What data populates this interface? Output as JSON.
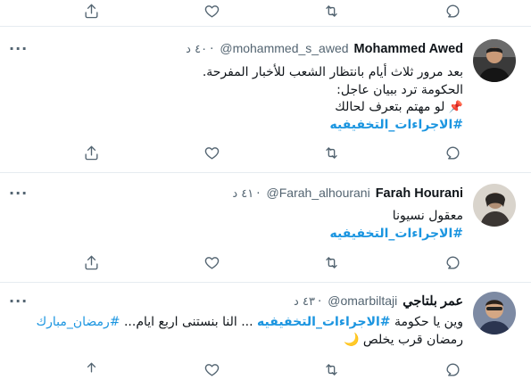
{
  "tweets": [
    {
      "name": "Mohammed Awed",
      "handle": "@mohammed_s_awed",
      "time": "٤٠ د",
      "line1": "بعد مرور ثلاث أيام بانتظار الشعب للأخبار المفرحة.",
      "line2": "الحكومة ترد ببيان عاجل:",
      "line3_icon": "📌",
      "line3": "لو مهتم بتعرف لحالك",
      "hashtag": "#الاجراءات_التخفيفيه"
    },
    {
      "name": "Farah Hourani",
      "handle": "@Farah_alhourani",
      "time": "٤١ د",
      "line1": "معقول نسيونا",
      "hashtag": "#الاجراءات_التخفيفيه"
    },
    {
      "name": "عمر بلتاجي",
      "handle": "@omarbiltaji",
      "time": "٤٣ د",
      "line1_prefix": "وين يا حكومة",
      "line1_hashtag": "#الاجراءات_التخفيفيه",
      "line1_mid": "... النا بنستنى اربع ايام...",
      "line1_hashtag2": "#رمضان_مبارك",
      "line2_icon": "🌙",
      "line2": "رمضان قرب يخلص"
    }
  ],
  "icons": {
    "reply": "reply-icon",
    "retweet": "retweet-icon",
    "like": "like-icon",
    "share": "share-icon",
    "more": "more-icon"
  },
  "dot": "·",
  "more_glyph": "···",
  "colors": {
    "link": "#1b95e0",
    "muted": "#536471",
    "divider": "#e6ecf0"
  }
}
